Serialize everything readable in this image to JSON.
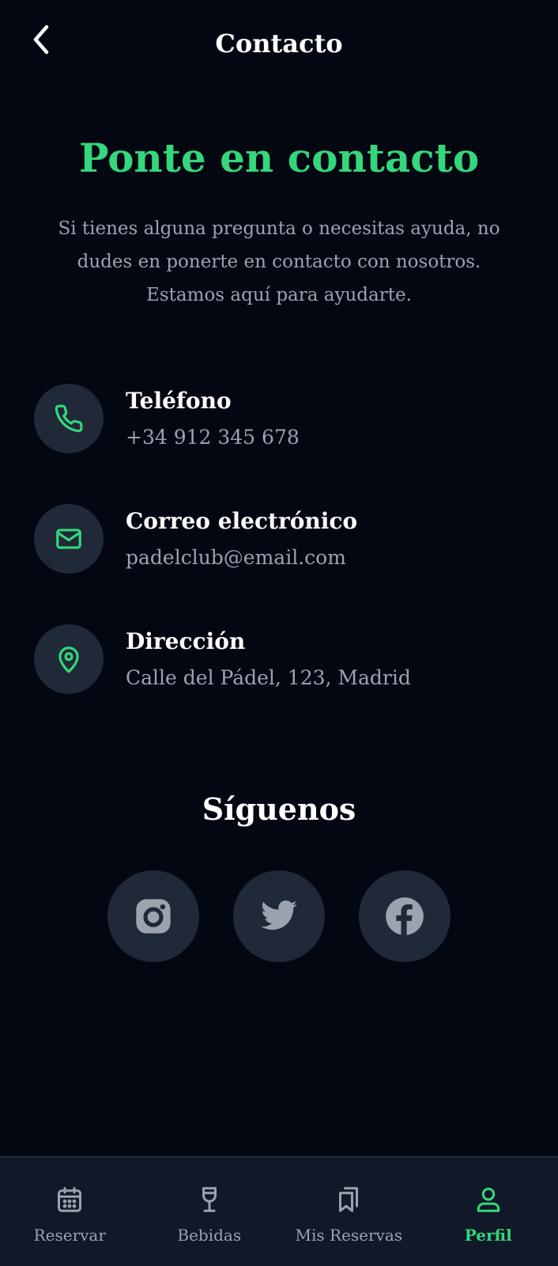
{
  "colors": {
    "accent": "#34d77b",
    "icon_muted": "#9ca3af",
    "background": "#030712"
  },
  "header": {
    "title": "Contacto",
    "back_icon": "chevron-left-icon"
  },
  "hero": {
    "title": "Ponte en contacto",
    "description": "Si tienes alguna pregunta o necesitas ayuda, no dudes en ponerte en contacto con nosotros. Estamos aquí para ayudarte."
  },
  "contacts": [
    {
      "label": "Teléfono",
      "value": "+34 912 345 678",
      "icon": "phone-icon"
    },
    {
      "label": "Correo electrónico",
      "value": "padelclub@email.com",
      "icon": "mail-icon"
    },
    {
      "label": "Dirección",
      "value": "Calle del Pádel, 123, Madrid",
      "icon": "map-pin-icon"
    }
  ],
  "social": {
    "title": "Síguenos",
    "items": [
      {
        "icon": "instagram-icon"
      },
      {
        "icon": "twitter-icon"
      },
      {
        "icon": "facebook-icon"
      }
    ]
  },
  "nav": {
    "items": [
      {
        "label": "Reservar",
        "icon": "calendar-icon",
        "active": false
      },
      {
        "label": "Bebidas",
        "icon": "wine-glass-icon",
        "active": false
      },
      {
        "label": "Mis Reservas",
        "icon": "bookmarks-icon",
        "active": false
      },
      {
        "label": "Perfil",
        "icon": "user-icon",
        "active": true
      }
    ]
  }
}
